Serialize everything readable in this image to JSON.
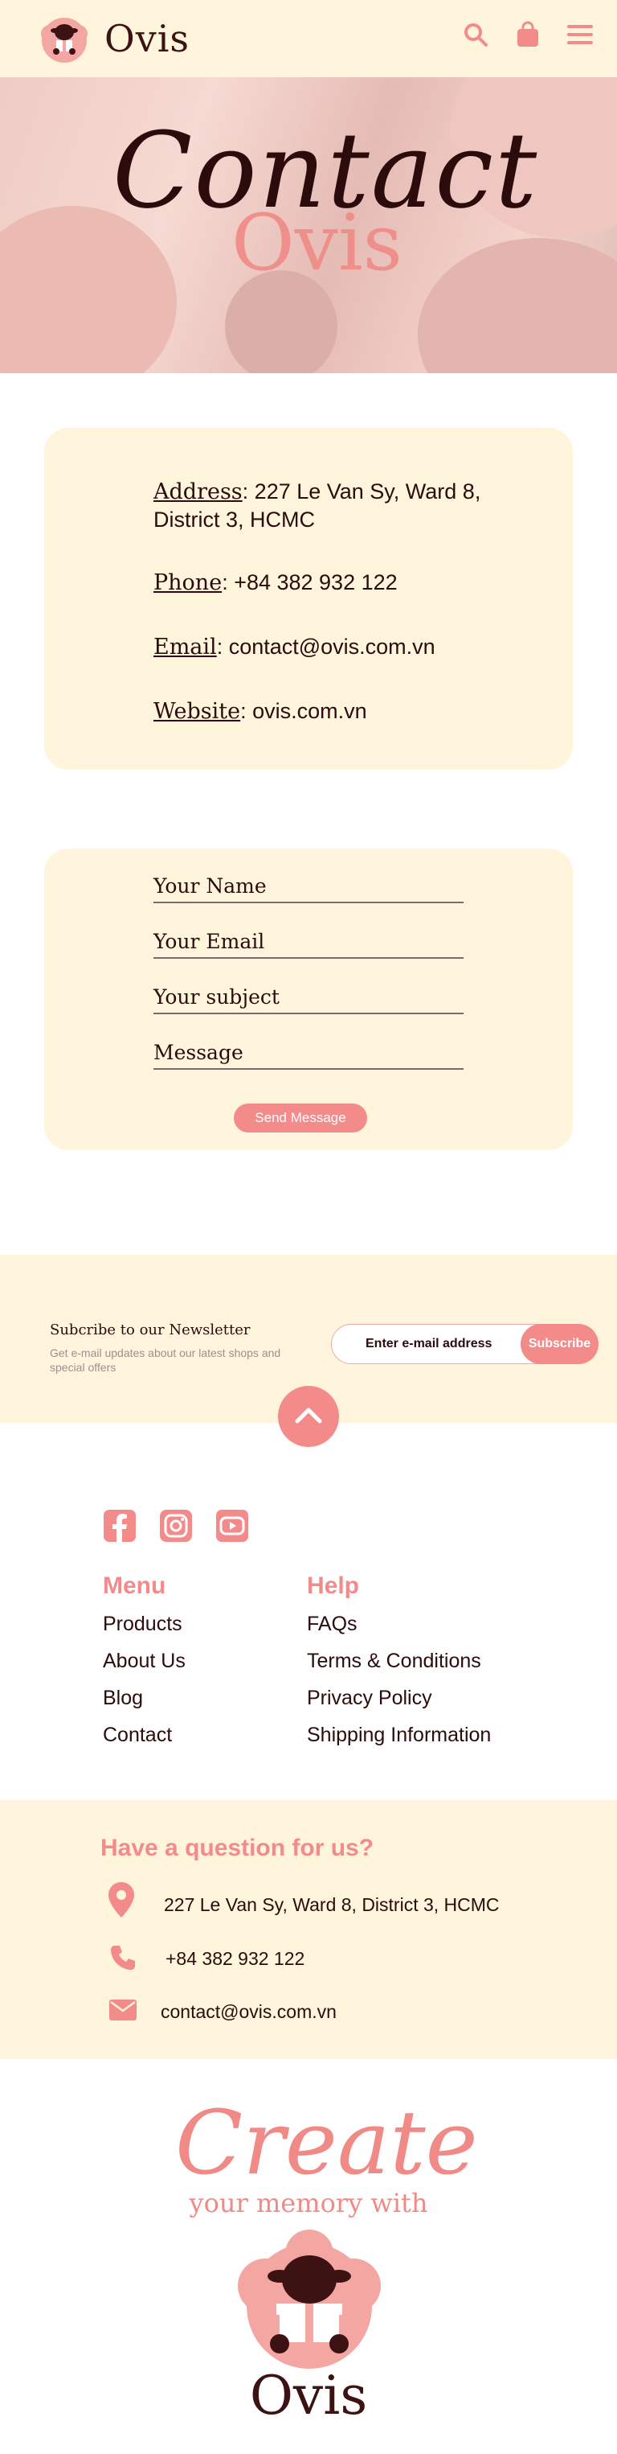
{
  "header": {
    "brand": "Ovis",
    "icons": [
      "search-icon",
      "shopping-bag-icon",
      "menu-icon"
    ],
    "accent": "#f48b8b",
    "background": "#fff4dc"
  },
  "hero": {
    "title": "Contact",
    "subtitle": "Ovis"
  },
  "contact_info": {
    "address_label": "Address",
    "address_value": ": 227 Le Van Sy, Ward 8,",
    "address_value_2": "District 3, HCMC",
    "phone_label": "Phone",
    "phone_value": ": +84 382 932 122",
    "email_label": "Email",
    "email_value": ": contact@ovis.com.vn",
    "website_label": "Website",
    "website_value": ": ovis.com.vn"
  },
  "form": {
    "name_placeholder": "Your Name",
    "email_placeholder": "Your Email",
    "subject_placeholder": "Your subject",
    "message_placeholder": "Message",
    "send_label": "Send Message"
  },
  "newsletter": {
    "title": "Subcribe to our Newsletter",
    "description": "Get e-mail updates about our latest shops and special offers",
    "input_placeholder": "Enter e-mail address",
    "button_label": "Subscribe"
  },
  "footer": {
    "social": [
      "facebook-icon",
      "instagram-icon",
      "youtube-icon"
    ],
    "menu_heading": "Menu",
    "menu_items": [
      "Products",
      "About Us",
      "Blog",
      "Contact"
    ],
    "help_heading": "Help",
    "help_items": [
      "FAQs",
      "Terms & Conditions",
      "Privacy Policy",
      "Shipping Information"
    ]
  },
  "question": {
    "title": "Have a question for us?",
    "address": "227 Le Van Sy, Ward 8,  District 3, HCMC",
    "phone": "+84 382 932 122",
    "email": "contact@ovis.com.vn"
  },
  "bottom": {
    "script_word": "Create",
    "tagline": "your memory with",
    "brand": "Ovis"
  }
}
